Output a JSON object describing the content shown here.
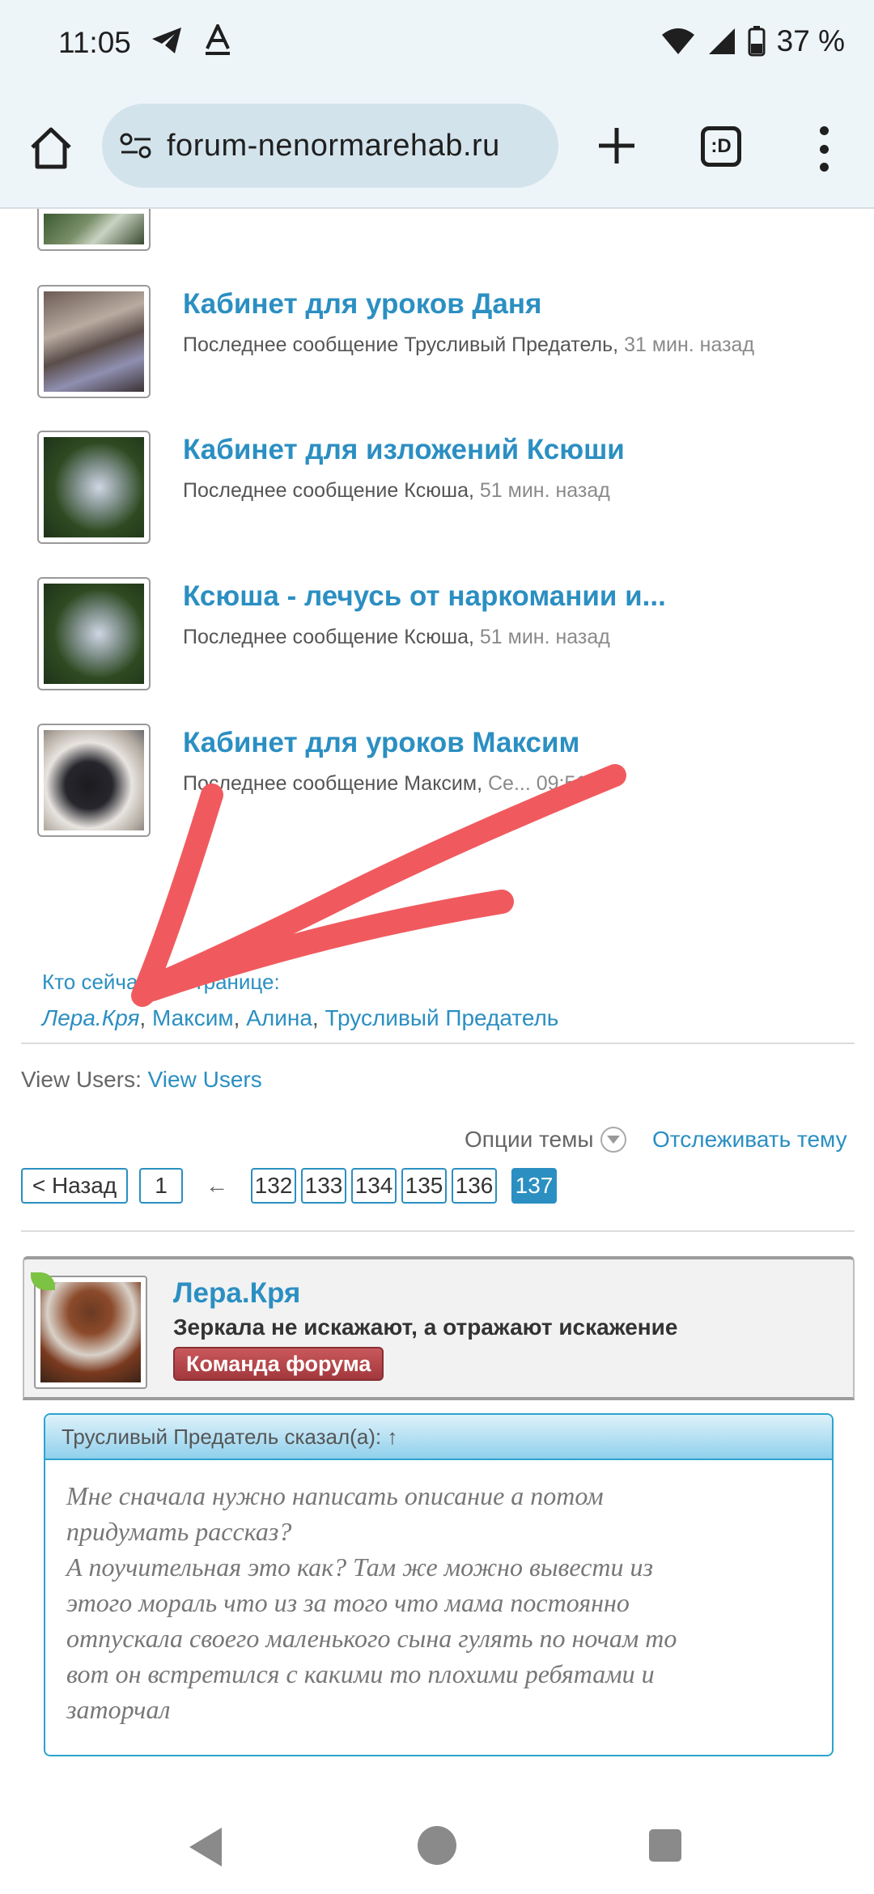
{
  "status": {
    "time": "11:05",
    "battery": "37 %"
  },
  "browser": {
    "url": "forum-nenormarehab.ru",
    "tabs_label": ":D"
  },
  "forums": [
    {
      "title": "Кабинет для уроков Даня",
      "last_prefix": "Последнее сообщение",
      "user": "Трусливый Предатель",
      "ago": "31 мин. назад"
    },
    {
      "title": "Кабинет для изложений Ксюши",
      "last_prefix": "Последнее сообщение",
      "user": "Ксюша",
      "ago": "51 мин. назад"
    },
    {
      "title": "Ксюша - лечусь от наркомании и...",
      "last_prefix": "Последнее сообщение",
      "user": "Ксюша",
      "ago": "51 мин. назад"
    },
    {
      "title": "Кабинет для уроков Максим",
      "last_prefix": "Последнее сообщение",
      "user": "Максим",
      "ago": "Се... 09:51"
    }
  ],
  "who": {
    "label": "Кто сейчас на странице:",
    "users": [
      "Лера.Кря",
      "Максим",
      "Алина",
      "Трусливый Предатель"
    ]
  },
  "view_users": {
    "label": "View Users:",
    "link": "View Users"
  },
  "thread": {
    "options_label": "Опции темы",
    "watch_label": "Отслеживать тему"
  },
  "pager": {
    "back": "< Назад",
    "first": "1",
    "arrow": "←",
    "pages": [
      "132",
      "133",
      "134",
      "135",
      "136"
    ],
    "current": "137"
  },
  "post": {
    "author": "Лера.Кря",
    "signature": "Зеркала не искажают, а отражают искажение",
    "badge": "Команда форума",
    "quote_header": "Трусливый Предатель сказал(а): ↑",
    "quote_lines": [
      "Мне сначала нужно написать описание а потом",
      "придумать рассказ?",
      "А поучительная это как? Там же можно вывести из",
      "этого мораль что из за того что мама постоянно",
      "отпускала своего маленького сына гулять по ночам то",
      "вот он встретился с какими то плохими ребятами и",
      "заторчал"
    ]
  },
  "colors": {
    "link": "#2b8fc2",
    "arrow": "#f05a5e",
    "badge": "#a2383c"
  }
}
